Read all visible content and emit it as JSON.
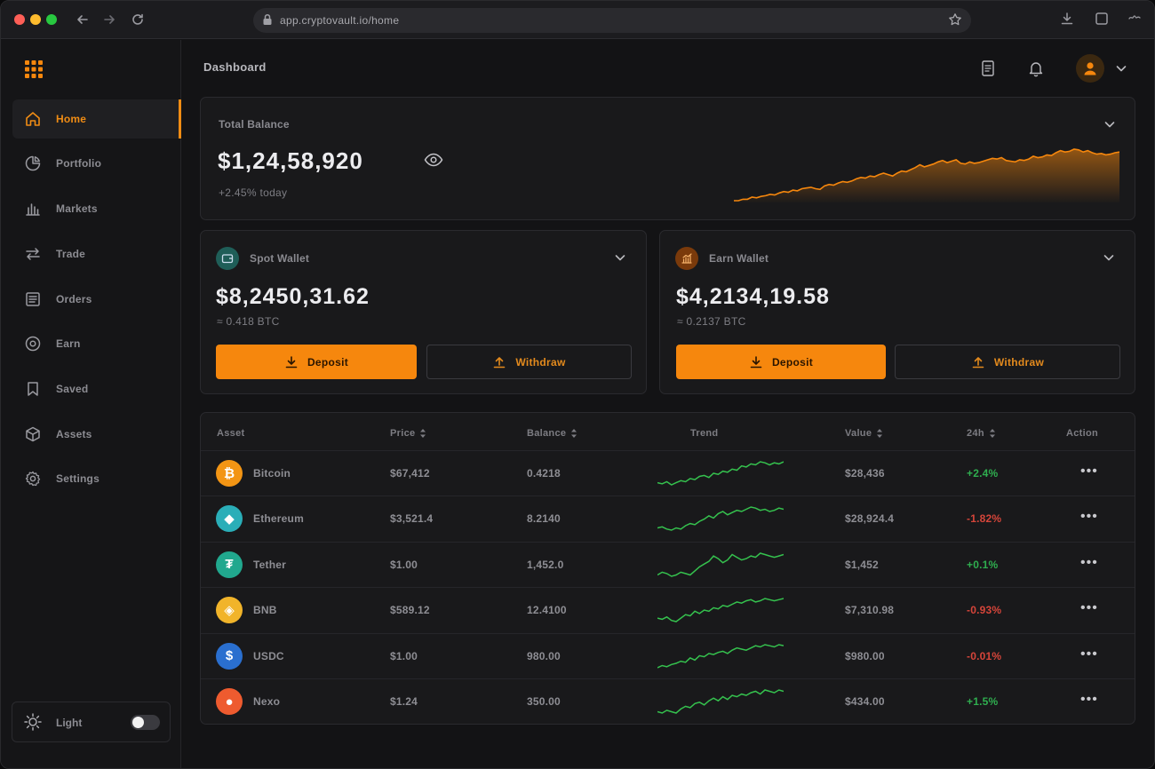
{
  "browser": {
    "url": "app.cryptovault.io/home"
  },
  "sidebar": {
    "items": [
      {
        "label": "Home",
        "icon": "home-icon"
      },
      {
        "label": "Portfolio",
        "icon": "pie-chart-icon"
      },
      {
        "label": "Markets",
        "icon": "bar-chart-icon"
      },
      {
        "label": "Trade",
        "icon": "swap-icon"
      },
      {
        "label": "Orders",
        "icon": "list-icon"
      },
      {
        "label": "Earn",
        "icon": "target-icon"
      },
      {
        "label": "Saved",
        "icon": "bookmark-icon"
      },
      {
        "label": "Assets",
        "icon": "box-icon"
      },
      {
        "label": "Settings",
        "icon": "gear-icon"
      }
    ],
    "theme_label": "Light"
  },
  "header": {
    "title": "Dashboard"
  },
  "overview": {
    "label": "Total Balance",
    "value": "$1,24,58,920",
    "sub": "+2.45% today",
    "chart_series": [
      1,
      1,
      3,
      3,
      6,
      5,
      7,
      8,
      10,
      9,
      12,
      14,
      13,
      16,
      15,
      18,
      19,
      20,
      18,
      17,
      22,
      24,
      23,
      26,
      28,
      27,
      29,
      32,
      34,
      33,
      36,
      35,
      38,
      40,
      38,
      36,
      40,
      43,
      42,
      45,
      48,
      52,
      49,
      51,
      53,
      56,
      58,
      55,
      57,
      59,
      54,
      53,
      56,
      54,
      55,
      57,
      59,
      61,
      60,
      62,
      58,
      57,
      56,
      59,
      58,
      60,
      64,
      62,
      63,
      66,
      65,
      69,
      72,
      70,
      71,
      74,
      73,
      70,
      72,
      69,
      67,
      68,
      66,
      67,
      69,
      70
    ]
  },
  "wallets": [
    {
      "label": "Spot Wallet",
      "value": "$8,2450,31.62",
      "sub": "≈ 0.418 BTC",
      "deposit": "Deposit",
      "withdraw": "Withdraw",
      "badge_color": "#1f6e66",
      "icon": "wallet-icon"
    },
    {
      "label": "Earn Wallet",
      "value": "$4,2134,19.58",
      "sub": "≈ 0.2137 BTC",
      "deposit": "Deposit",
      "withdraw": "Withdraw",
      "badge_color": "#7a3a0b",
      "icon": "growth-chart-icon"
    }
  ],
  "table": {
    "columns": [
      "Asset",
      "Price",
      "Balance",
      "Trend",
      "Value",
      "24h",
      "Action"
    ],
    "rows": [
      {
        "name": "Bitcoin",
        "price": "$67,412",
        "balance": "0.4218",
        "value": "$28,436",
        "change": "+2.4%",
        "dir": "up",
        "color": "#f39514",
        "glyph": "₿",
        "icon": "bitcoin-icon",
        "trend": [
          5,
          4,
          6,
          3,
          5,
          7,
          6,
          9,
          8,
          11,
          12,
          10,
          14,
          13,
          16,
          15,
          18,
          17,
          21,
          20,
          23,
          22,
          25,
          24,
          22,
          24,
          23,
          25
        ]
      },
      {
        "name": "Ethereum",
        "price": "$3,521.4",
        "balance": "8.2140",
        "value": "$28,924.4",
        "change": "-1.82%",
        "dir": "down",
        "color": "#2aaeb8",
        "glyph": "◆",
        "icon": "ethereum-icon",
        "trend": [
          5,
          6,
          4,
          3,
          5,
          4,
          7,
          9,
          8,
          11,
          13,
          16,
          14,
          18,
          20,
          17,
          19,
          21,
          20,
          22,
          24,
          23,
          21,
          22,
          20,
          21,
          23,
          22
        ]
      },
      {
        "name": "Tether",
        "price": "$1.00",
        "balance": "1,452.0",
        "value": "$1,452",
        "change": "+0.1%",
        "dir": "up",
        "color": "#21a88e",
        "glyph": "₮",
        "icon": "tether-icon",
        "trend": [
          4,
          6,
          5,
          3,
          4,
          6,
          5,
          4,
          7,
          10,
          12,
          14,
          18,
          16,
          13,
          15,
          19,
          17,
          15,
          16,
          18,
          17,
          20,
          19,
          18,
          17,
          18,
          19
        ]
      },
      {
        "name": "BNB",
        "price": "$589.12",
        "balance": "12.4100",
        "value": "$7,310.98",
        "change": "-0.93%",
        "dir": "down",
        "color": "#f1b42a",
        "glyph": "◈",
        "icon": "bnb-icon",
        "trend": [
          6,
          5,
          7,
          4,
          3,
          6,
          9,
          8,
          12,
          10,
          13,
          12,
          15,
          14,
          17,
          16,
          18,
          20,
          19,
          21,
          22,
          20,
          21,
          23,
          22,
          21,
          22,
          23
        ]
      },
      {
        "name": "USDC",
        "price": "$1.00",
        "balance": "980.00",
        "value": "$980.00",
        "change": "-0.01%",
        "dir": "down",
        "color": "#2a6fcf",
        "glyph": "$",
        "icon": "usdc-icon",
        "trend": [
          3,
          5,
          4,
          6,
          7,
          9,
          8,
          12,
          10,
          14,
          13,
          16,
          15,
          17,
          18,
          16,
          19,
          21,
          20,
          19,
          21,
          23,
          22,
          24,
          23,
          22,
          24,
          23
        ]
      },
      {
        "name": "Nexo",
        "price": "$1.24",
        "balance": "350.00",
        "value": "$434.00",
        "change": "+1.5%",
        "dir": "up",
        "color": "#ee5b2f",
        "glyph": "●",
        "icon": "nexo-icon",
        "trend": [
          4,
          3,
          5,
          4,
          3,
          6,
          8,
          7,
          10,
          11,
          9,
          12,
          14,
          12,
          15,
          13,
          16,
          15,
          17,
          16,
          18,
          19,
          17,
          20,
          19,
          18,
          20,
          19
        ]
      }
    ]
  },
  "colors": {
    "accent": "#f6870d",
    "positive": "#2fae4f",
    "negative": "#d6453a",
    "sparkline": "#35c24e"
  }
}
